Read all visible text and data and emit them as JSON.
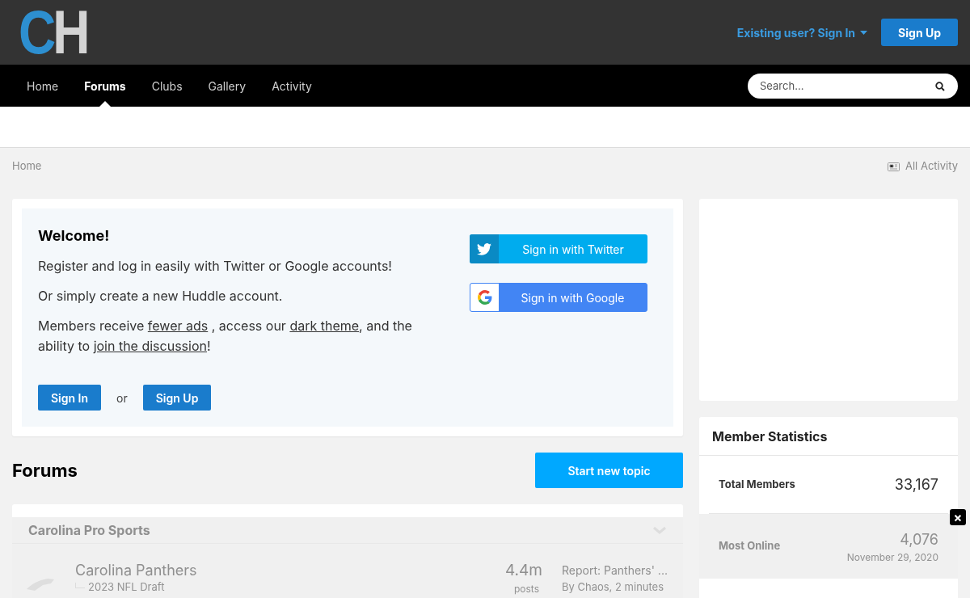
{
  "header": {
    "logo": {
      "first": "C",
      "second": "H"
    },
    "sign_in": "Existing user? Sign In",
    "sign_up": "Sign Up"
  },
  "nav": {
    "items": [
      {
        "label": "Home",
        "selected": false
      },
      {
        "label": "Forums",
        "selected": true
      },
      {
        "label": "Clubs",
        "selected": false
      },
      {
        "label": "Gallery",
        "selected": false
      },
      {
        "label": "Activity",
        "selected": false
      }
    ],
    "search": {
      "placeholder": "Search..."
    }
  },
  "breadcrumb": {
    "home": "Home",
    "all_activity": "All Activity"
  },
  "welcome": {
    "title": "Welcome!",
    "paragraphs": [
      "Register and log in easily with Twitter or Google accounts!",
      "Or simply create a new Huddle account."
    ],
    "members_text": [
      {
        "kind": "text",
        "text": "Members receive "
      },
      {
        "kind": "link",
        "text": "fewer ads"
      },
      {
        "kind": "text",
        "text": " , access our "
      },
      {
        "kind": "link",
        "text": "dark theme"
      },
      {
        "kind": "text",
        "text": ", and the ability to "
      },
      {
        "kind": "link",
        "text": "join the discussion"
      },
      {
        "kind": "text",
        "text": "!"
      }
    ],
    "sign_in": "Sign In",
    "or": "or",
    "sign_up": "Sign Up",
    "social": [
      {
        "kind": "twitter",
        "label": "Sign in with Twitter"
      },
      {
        "kind": "google",
        "label": "Sign in with Google"
      }
    ]
  },
  "forums": {
    "title": "Forums",
    "start_topic": "Start new topic",
    "category": "Carolina Pro Sports",
    "rows": [
      {
        "name": "Carolina Panthers",
        "subforum": "2023 NFL Draft",
        "count": "4.4m",
        "count_label": "posts",
        "last_post": "Report: Panthers' ...",
        "last_by": "By Chaos, 2 minutes"
      }
    ]
  },
  "member_statistics": {
    "title": "Member Statistics",
    "stats": [
      {
        "label": "Total Members",
        "value": "33,167"
      },
      {
        "label": "Most Online",
        "value": "4,076",
        "date": "November 29, 2020"
      }
    ]
  },
  "overlay": {
    "close": "×"
  }
}
